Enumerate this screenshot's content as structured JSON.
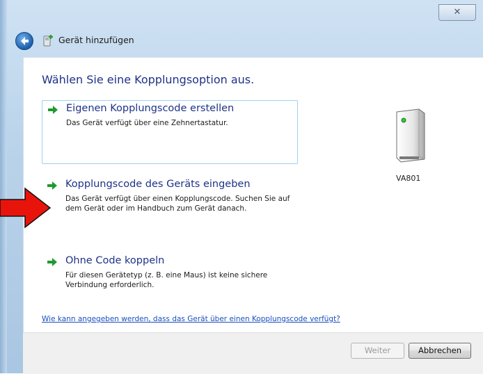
{
  "window": {
    "close_glyph": "✕",
    "title": "Gerät hinzufügen"
  },
  "main": {
    "heading": "Wählen Sie eine Kopplungsoption aus.",
    "options": [
      {
        "title": "Eigenen Kopplungscode erstellen",
        "description": "Das Gerät verfügt über eine Zehnertastatur.",
        "selected": true
      },
      {
        "title": "Kopplungscode des Geräts eingeben",
        "description": "Das Gerät verfügt über einen Kopplungscode. Suchen Sie auf dem Gerät oder im Handbuch zum Gerät danach.",
        "selected": false
      },
      {
        "title": "Ohne Code koppeln",
        "description": "Für diesen Gerätetyp (z. B. eine Maus) ist keine sichere Verbindung erforderlich.",
        "selected": false
      }
    ],
    "device": {
      "name": "VA801",
      "icon": "device-tower-icon"
    },
    "help_link": "Wie kann angegeben werden, dass das Gerät über einen Kopplungscode verfügt?"
  },
  "footer": {
    "next_label": "Weiter",
    "next_enabled": false,
    "cancel_label": "Abbrechen"
  },
  "annotation": {
    "icon": "red-arrow-icon",
    "color": "#e8140c"
  },
  "colors": {
    "heading": "#1e3287",
    "link": "#1a4fbf",
    "option_arrow": "#1f9a2d"
  }
}
